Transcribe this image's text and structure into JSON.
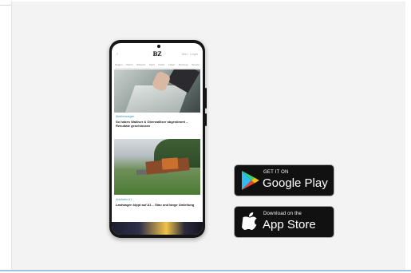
{
  "phone": {
    "logo": "BZ",
    "header_left": "≡",
    "header_right": "Abo · Login",
    "nav": [
      "Region",
      "Zürich",
      "Schweiz",
      "Sport",
      "Kultur",
      "Leben",
      "Meinung",
      "Service"
    ],
    "article1": {
      "tag": "Abstimmungen",
      "title": "So haben Walliser & Oberwalliser abgestimmt – Resultate geschlossen"
    },
    "article2": {
      "tag": "Autobahn A1",
      "title": "Lastwagen kippt auf A1 – Stau und lange Umleitung"
    }
  },
  "stores": {
    "google_play": {
      "small": "GET IT ON",
      "big": "Google Play"
    },
    "app_store": {
      "small": "Download on the",
      "big": "App Store"
    }
  },
  "colors": {
    "badge_bg": "#111111",
    "accent_line": "#9fc3d8",
    "panel_bg": "#f3f3f3"
  }
}
